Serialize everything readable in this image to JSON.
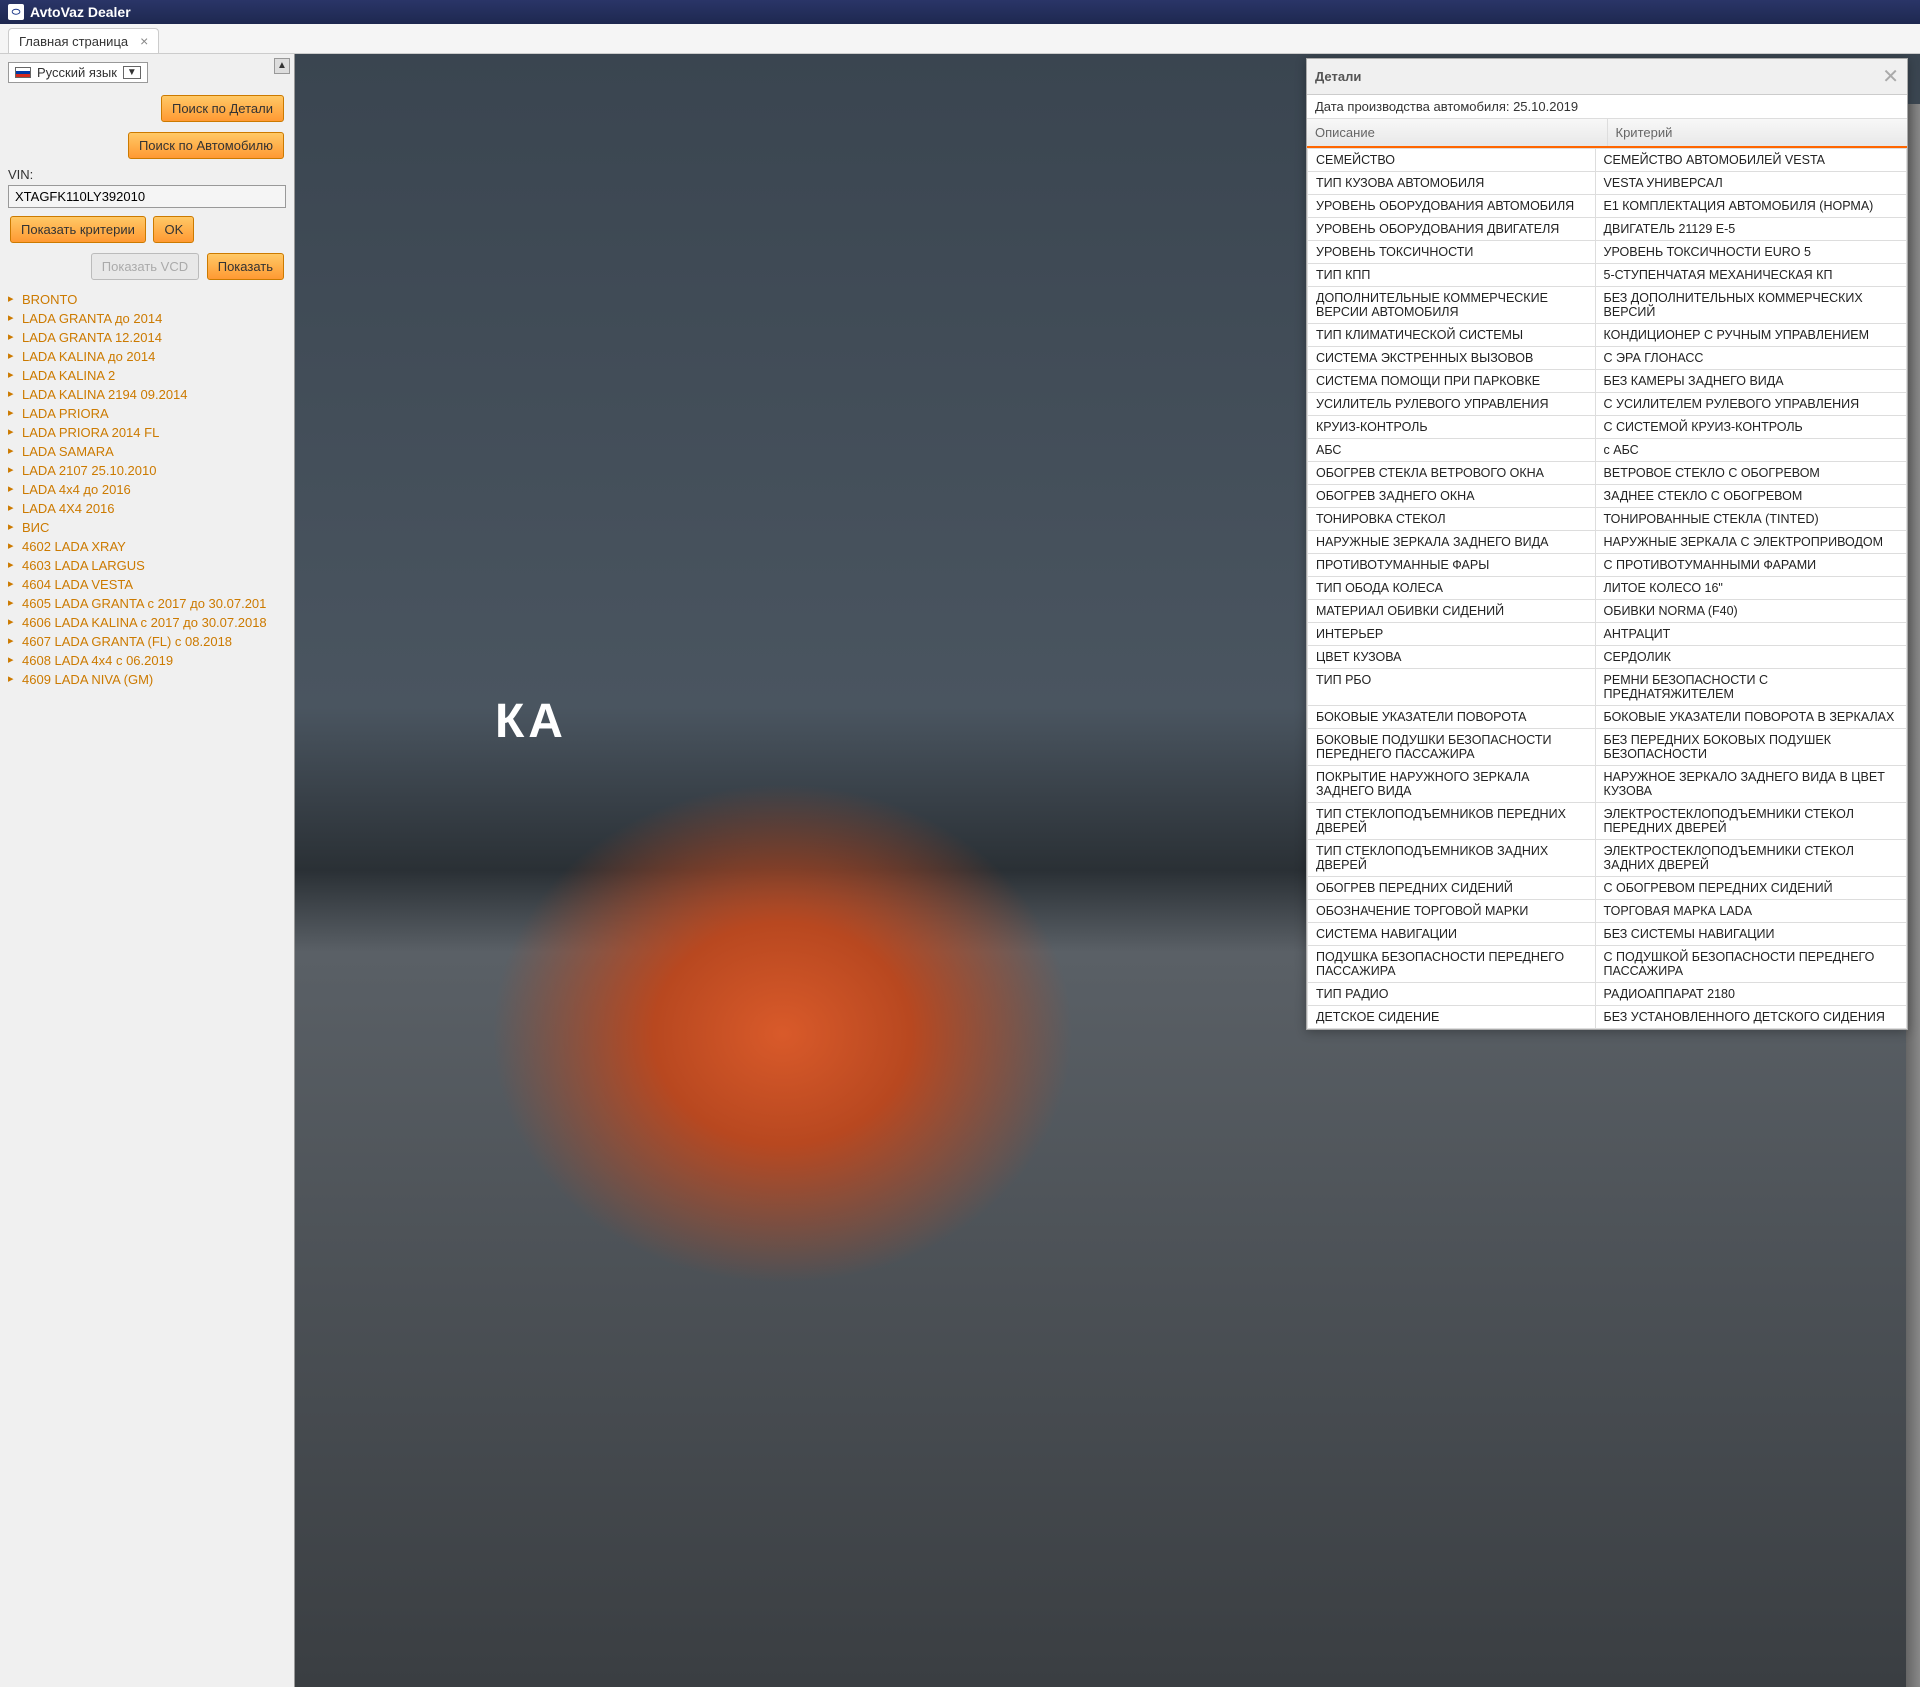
{
  "title": "AvtoVaz Dealer",
  "tab": {
    "label": "Главная страница"
  },
  "sidebar": {
    "language": "Русский язык",
    "btn_search_part": "Поиск по Детали",
    "btn_search_car": "Поиск по Автомобилю",
    "vin_label": "VIN:",
    "vin_value": "XTAGFK110LY392010",
    "btn_show_criteria": "Показать критерии",
    "btn_ok": "OK",
    "btn_show_vcd": "Показать VCD",
    "btn_show": "Показать",
    "tree": [
      "BRONTO",
      "LADA GRANTA до 2014",
      "LADA GRANTA 12.2014",
      "LADA KALINA до 2014",
      "LADA KALINA 2",
      "LADA KALINA 2194 09.2014",
      "LADA PRIORA",
      "LADA PRIORA 2014 FL",
      "LADA SAMARA",
      "LADA 2107 25.10.2010",
      "LADA 4x4 до 2016",
      "LADA 4X4 2016",
      "ВИС",
      "4602 LADA XRAY",
      "4603 LADA LARGUS",
      "4604 LADA VESTA",
      "4605 LADA GRANTA с 2017 до 30.07.201",
      "4606 LADA KALINA с 2017 до 30.07.2018",
      "4607 LADA GRANTA (FL) с 08.2018",
      "4608 LADA 4x4 с 06.2019",
      "4609 LADA NIVA (GM)"
    ]
  },
  "main": {
    "big_text": "КА"
  },
  "details": {
    "title": "Детали",
    "date": "Дата производства автомобиля: 25.10.2019",
    "col1": "Описание",
    "col2": "Критерий",
    "rows": [
      [
        "СЕМЕЙСТВО",
        "СЕМЕЙСТВО АВТОМОБИЛЕЙ VESTA"
      ],
      [
        "ТИП КУЗОВА АВТОМОБИЛЯ",
        "VESTA УНИВЕРСАЛ"
      ],
      [
        "УРОВЕНЬ ОБОРУДОВАНИЯ АВТОМОБИЛЯ",
        "Е1 КОМПЛЕКТАЦИЯ АВТОМОБИЛЯ (НОРМА)"
      ],
      [
        "УРОВЕНЬ ОБОРУДОВАНИЯ ДВИГАТЕЛЯ",
        "ДВИГАТЕЛЬ 21129 Е-5"
      ],
      [
        "УРОВЕНЬ ТОКСИЧНОСТИ",
        "УРОВЕНЬ ТОКСИЧНОСТИ EURO 5"
      ],
      [
        "ТИП КПП",
        "5-СТУПЕНЧАТАЯ МЕХАНИЧЕСКАЯ КП"
      ],
      [
        "ДОПОЛНИТЕЛЬНЫЕ КОММЕРЧЕСКИЕ ВЕРСИИ АВТОМОБИЛЯ",
        "БЕЗ ДОПОЛНИТЕЛЬНЫХ КОММЕРЧЕСКИХ ВЕРСИЙ"
      ],
      [
        "ТИП КЛИМАТИЧЕСКОЙ СИСТЕМЫ",
        "КОНДИЦИОНЕР С РУЧНЫМ УПРАВЛЕНИЕМ"
      ],
      [
        "СИСТЕМА ЭКСТРЕННЫХ ВЫЗОВОВ",
        "С ЭРА ГЛОНАСС"
      ],
      [
        "СИСТЕМА ПОМОЩИ ПРИ ПАРКОВКЕ",
        "БЕЗ КАМЕРЫ ЗАДНЕГО ВИДА"
      ],
      [
        "УСИЛИТЕЛЬ РУЛЕВОГО УПРАВЛЕНИЯ",
        "С УСИЛИТЕЛЕМ РУЛЕВОГО УПРАВЛЕНИЯ"
      ],
      [
        "КРУИЗ-КОНТРОЛЬ",
        "С СИСТЕМОЙ КРУИЗ-КОНТРОЛЬ"
      ],
      [
        "АБС",
        "с АБС"
      ],
      [
        "ОБОГРЕВ СТЕКЛА ВЕТРОВОГО ОКНА",
        "ВЕТРОВОЕ СТЕКЛО С ОБОГРЕВОМ"
      ],
      [
        "ОБОГРЕВ ЗАДНЕГО ОКНА",
        "ЗАДНЕЕ СТЕКЛО С ОБОГРЕВОМ"
      ],
      [
        "ТОНИРОВКА СТЕКОЛ",
        "ТОНИРОВАННЫЕ СТЕКЛА (TINTED)"
      ],
      [
        "НАРУЖНЫЕ ЗЕРКАЛА ЗАДНЕГО ВИДА",
        "НАРУЖНЫЕ ЗЕРКАЛА С ЭЛЕКТРОПРИВОДОМ"
      ],
      [
        "ПРОТИВОТУМАННЫЕ ФАРЫ",
        "С ПРОТИВОТУМАННЫМИ ФАРАМИ"
      ],
      [
        "ТИП ОБОДА КОЛЕСА",
        "ЛИТОЕ КОЛЕСО 16\""
      ],
      [
        "МАТЕРИАЛ ОБИВКИ СИДЕНИЙ",
        "ОБИВКИ NORMA (F40)"
      ],
      [
        "ИНТЕРЬЕР",
        "АНТРАЦИТ"
      ],
      [
        "ЦВЕТ КУЗОВА",
        "СЕРДОЛИК"
      ],
      [
        "ТИП РБО",
        "РЕМНИ БЕЗОПАСНОСТИ С ПРЕДНАТЯЖИТЕЛЕМ"
      ],
      [
        "БОКОВЫЕ УКАЗАТЕЛИ ПОВОРОТА",
        "БОКОВЫЕ УКАЗАТЕЛИ ПОВОРОТА В ЗЕРКАЛАХ"
      ],
      [
        "БОКОВЫЕ ПОДУШКИ БЕЗОПАСНОСТИ ПЕРЕДНЕГО ПАССАЖИРА",
        "БЕЗ ПЕРЕДНИХ БОКОВЫХ ПОДУШЕК БЕЗОПАСНОСТИ"
      ],
      [
        "ПОКРЫТИЕ НАРУЖНОГО ЗЕРКАЛА ЗАДНЕГО ВИДА",
        "НАРУЖНОЕ ЗЕРКАЛО ЗАДНЕГО ВИДА В ЦВЕТ КУЗОВА"
      ],
      [
        "ТИП СТЕКЛОПОДЪЕМНИКОВ ПЕРЕДНИХ ДВЕРЕЙ",
        "ЭЛЕКТРОСТЕКЛОПОДЪЕМНИКИ СТЕКОЛ ПЕРЕДНИХ ДВЕРЕЙ"
      ],
      [
        "ТИП СТЕКЛОПОДЪЕМНИКОВ ЗАДНИХ ДВЕРЕЙ",
        "ЭЛЕКТРОСТЕКЛОПОДЪЕМНИКИ СТЕКОЛ ЗАДНИХ ДВЕРЕЙ"
      ],
      [
        "ОБОГРЕВ ПЕРЕДНИХ СИДЕНИЙ",
        "С ОБОГРЕВОМ ПЕРЕДНИХ СИДЕНИЙ"
      ],
      [
        "ОБОЗНАЧЕНИЕ ТОРГОВОЙ МАРКИ",
        "ТОРГОВАЯ МАРКА LADA"
      ],
      [
        "СИСТЕМА НАВИГАЦИИ",
        "БЕЗ СИСТЕМЫ НАВИГАЦИИ"
      ],
      [
        "ПОДУШКА БЕЗОПАСНОСТИ ПЕРЕДНЕГО ПАССАЖИРА",
        "С ПОДУШКОЙ БЕЗОПАСНОСТИ ПЕРЕДНЕГО ПАССАЖИРА"
      ],
      [
        "ТИП РАДИО",
        "РАДИОАППАРАТ 2180"
      ],
      [
        "ДЕТСКОЕ СИДЕНИЕ",
        "БЕЗ УСТАНОВЛЕННОГО ДЕТСКОГО СИДЕНИЯ"
      ]
    ]
  }
}
